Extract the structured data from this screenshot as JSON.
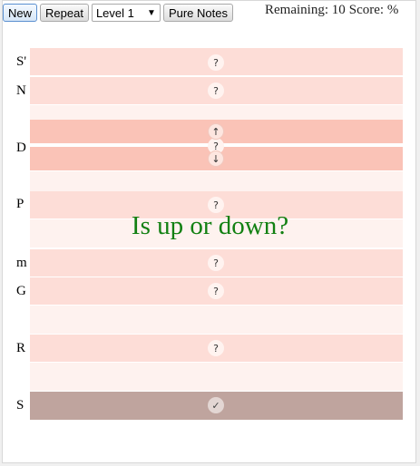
{
  "toolbar": {
    "new_label": "New",
    "repeat_label": "Repeat",
    "level_value": "Level 1",
    "pure_notes_label": "Pure Notes"
  },
  "status": {
    "remaining": "Remaining: 10",
    "score": "Score: %"
  },
  "notes": {
    "s_prime": "S'",
    "n": "N",
    "d": "D",
    "p": "P",
    "m": "m",
    "g": "G",
    "r": "R",
    "s": "S"
  },
  "marks": {
    "question": "?",
    "up": "↑",
    "down": "↓",
    "check": "✓"
  },
  "prompt": "Is up or down?",
  "colors": {
    "band_dark": "#fdddd7",
    "band_light": "#fef2ef",
    "band_strong": "#fac3b7",
    "band_done": "#bfa49e",
    "prompt_green": "#128012"
  }
}
